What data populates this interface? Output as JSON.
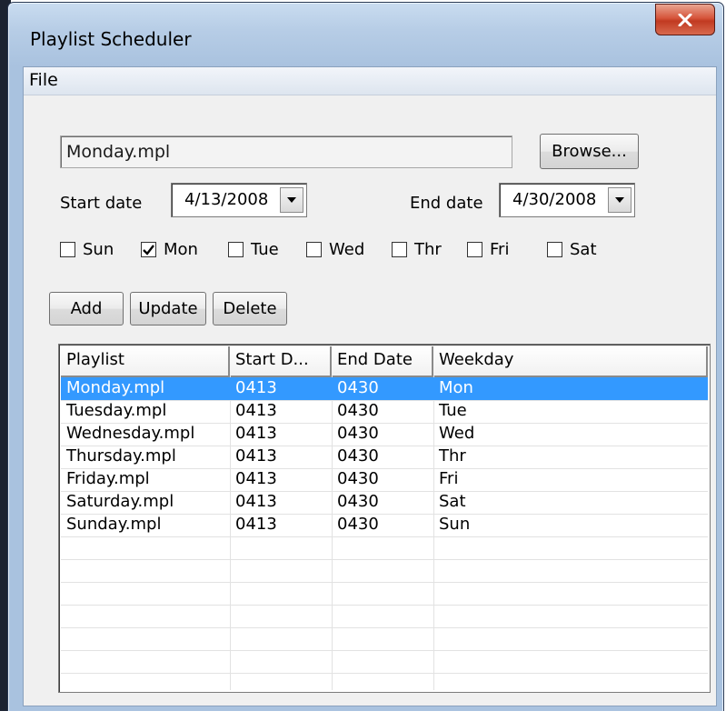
{
  "window": {
    "title": "Playlist Scheduler"
  },
  "menu": {
    "file_label": "File"
  },
  "form": {
    "file_value": "Monday.mpl",
    "browse_label": "Browse...",
    "start_label": "Start date",
    "start_value": "4/13/2008",
    "end_label": "End date",
    "end_value": "4/30/2008"
  },
  "weekdays": [
    {
      "label": "Sun",
      "checked": false
    },
    {
      "label": "Mon",
      "checked": true
    },
    {
      "label": "Tue",
      "checked": false
    },
    {
      "label": "Wed",
      "checked": false
    },
    {
      "label": "Thr",
      "checked": false
    },
    {
      "label": "Fri",
      "checked": false
    },
    {
      "label": "Sat",
      "checked": false
    }
  ],
  "actions": {
    "add_label": "Add",
    "update_label": "Update",
    "delete_label": "Delete"
  },
  "list": {
    "columns": [
      "Playlist",
      "Start D...",
      "End Date",
      "Weekday"
    ],
    "rows": [
      [
        "Monday.mpl",
        "0413",
        "0430",
        "Mon"
      ],
      [
        "Tuesday.mpl",
        "0413",
        "0430",
        "Tue"
      ],
      [
        "Wednesday.mpl",
        "0413",
        "0430",
        "Wed"
      ],
      [
        "Thursday.mpl",
        "0413",
        "0430",
        "Thr"
      ],
      [
        "Friday.mpl",
        "0413",
        "0430",
        "Fri"
      ],
      [
        "Saturday.mpl",
        "0413",
        "0430",
        "Sat"
      ],
      [
        "Sunday.mpl",
        "0413",
        "0430",
        "Sun"
      ]
    ],
    "selected_row": 0
  },
  "colors": {
    "selection": "#3399ff",
    "close_button": "#c9452c",
    "titlebar": "#b7cde6"
  }
}
